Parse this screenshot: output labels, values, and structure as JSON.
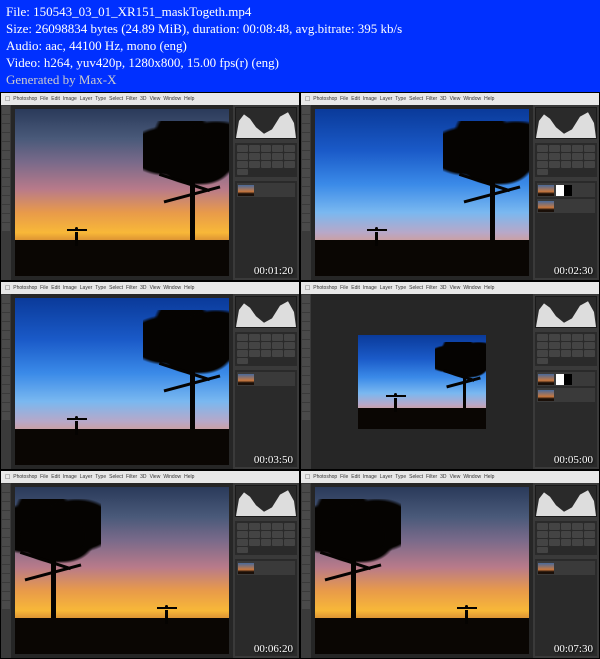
{
  "header": {
    "file_label": "File:",
    "filename": "150543_03_01_XR151_maskTogeth.mp4",
    "size_label": "Size:",
    "size_bytes": "26098834 bytes",
    "size_human": "(24.89 MiB)",
    "duration_label": "duration:",
    "duration": "00:08:48",
    "bitrate_label": "avg.bitrate:",
    "bitrate": "395 kb/s",
    "audio_label": "Audio:",
    "audio": "aac, 44100 Hz, mono (eng)",
    "video_label": "Video:",
    "video": "h264, yuv420p, 1280x800, 15.00 fps(r) (eng)",
    "generated": "Generated by Max-X"
  },
  "menu": {
    "app": "Photoshop",
    "items": [
      "File",
      "Edit",
      "Image",
      "Layer",
      "Type",
      "Select",
      "Filter",
      "3D",
      "View",
      "Window",
      "Help"
    ]
  },
  "thumbnails": [
    {
      "timestamp": "00:01:20",
      "sky": "warm",
      "treeSide": "right",
      "surferX": 28,
      "small": false
    },
    {
      "timestamp": "00:02:30",
      "sky": "blue",
      "treeSide": "right",
      "surferX": 28,
      "small": false,
      "maskLayer": true
    },
    {
      "timestamp": "00:03:50",
      "sky": "blue",
      "treeSide": "right",
      "surferX": 28,
      "small": false
    },
    {
      "timestamp": "00:05:00",
      "sky": "blue",
      "treeSide": "right",
      "surferX": 28,
      "small": true,
      "maskLayer": true
    },
    {
      "timestamp": "00:06:20",
      "sky": "warm",
      "treeSide": "left",
      "surferX": 70,
      "small": false
    },
    {
      "timestamp": "00:07:30",
      "sky": "warm",
      "treeSide": "left",
      "surferX": 70,
      "small": false
    }
  ],
  "skies": {
    "warm": "linear-gradient(to bottom,#2a3a5a 0%,#4a5a7a 18%,#7a6a8a 32%,#b87a8a 48%,#e89a4a 62%,#f8b838 74%,#c87830 82%,#1a0f08 88%)",
    "blue": "linear-gradient(to bottom,#0a3a9a 0%,#1a5ac8 25%,#3a8ae8 45%,#7ab8f0 62%,#b8a8c8 74%,#d89a8a 82%,#1a0f08 88%)"
  }
}
